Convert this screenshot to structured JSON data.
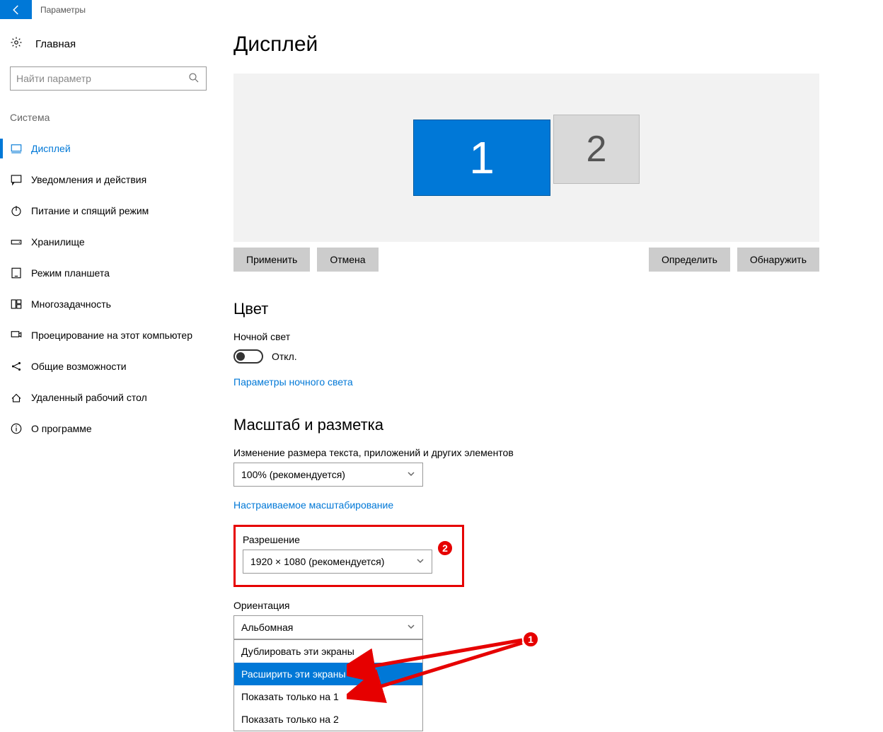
{
  "titlebar": {
    "title": "Параметры"
  },
  "sidebar": {
    "home": "Главная",
    "search_placeholder": "Найти параметр",
    "section": "Система",
    "items": [
      {
        "label": "Дисплей"
      },
      {
        "label": "Уведомления и действия"
      },
      {
        "label": "Питание и спящий режим"
      },
      {
        "label": "Хранилище"
      },
      {
        "label": "Режим планшета"
      },
      {
        "label": "Многозадачность"
      },
      {
        "label": "Проецирование на этот компьютер"
      },
      {
        "label": "Общие возможности"
      },
      {
        "label": "Удаленный рабочий стол"
      },
      {
        "label": "О программе"
      }
    ]
  },
  "main": {
    "heading": "Дисплей",
    "monitors": {
      "m1": "1",
      "m2": "2"
    },
    "buttons": {
      "apply": "Применить",
      "cancel": "Отмена",
      "identify": "Определить",
      "detect": "Обнаружить"
    },
    "color": {
      "heading": "Цвет",
      "nightlight_label": "Ночной свет",
      "nightlight_state": "Откл.",
      "nightlight_link": "Параметры ночного света"
    },
    "scale": {
      "heading": "Масштаб и разметка",
      "size_label": "Изменение размера текста, приложений и других элементов",
      "size_value": "100% (рекомендуется)",
      "custom_link": "Настраиваемое масштабирование",
      "resolution_label": "Разрешение",
      "resolution_value": "1920 × 1080 (рекомендуется)",
      "orientation_label": "Ориентация",
      "orientation_value": "Альбомная"
    },
    "multi_options": [
      "Дублировать эти экраны",
      "Расширить эти экраны",
      "Показать только на 1",
      "Показать только на 2"
    ],
    "annotations": {
      "badge1": "1",
      "badge2": "2"
    }
  }
}
